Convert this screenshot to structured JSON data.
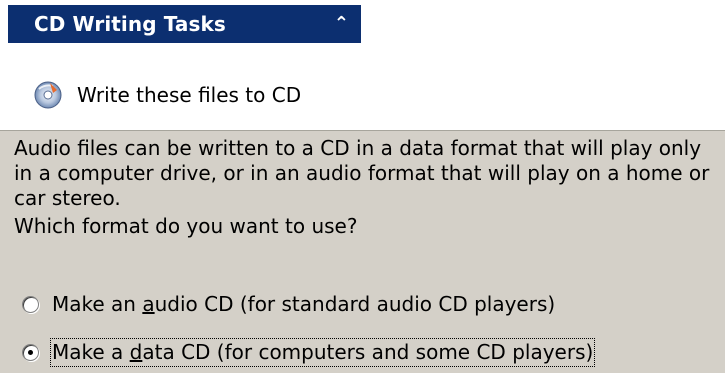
{
  "task_pane": {
    "title": "CD Writing Tasks",
    "collapse_icon": "chevron-double-up-icon",
    "task": {
      "icon": "cd-burn-icon",
      "label": "Write these files to CD"
    }
  },
  "dialog": {
    "description": "Audio files can be written to a CD in a data format that will play only in a computer drive, or in an audio format that will play on a home or car stereo.",
    "question": "Which format do you want to use?",
    "options": [
      {
        "prefix": "Make an ",
        "accel": "a",
        "suffix": "udio CD (for standard audio CD players)",
        "selected": false
      },
      {
        "prefix": "Make a ",
        "accel": "d",
        "suffix": "ata CD (for computers and some CD players)",
        "selected": true
      }
    ]
  }
}
